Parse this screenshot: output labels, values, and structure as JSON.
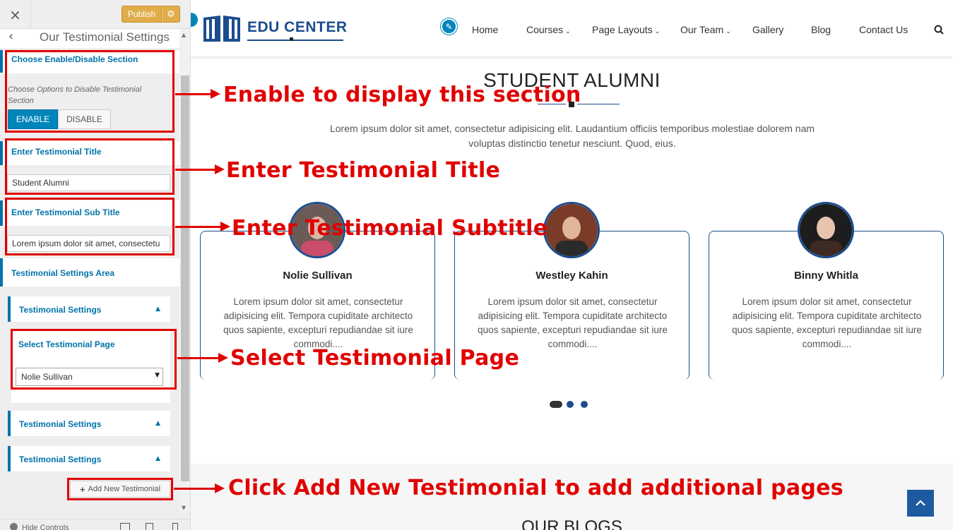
{
  "customizer": {
    "close_symbol": "×",
    "publish_label": "Publish",
    "gear_symbol": "⚙",
    "back_symbol": "‹",
    "section_title": "Our Testimonial Settings",
    "enable_section": {
      "title": "Choose Enable/Disable Section",
      "description": "Choose Options to Disable Testimonial Section",
      "enable_label": "ENABLE",
      "disable_label": "DISABLE",
      "selected": "ENABLE"
    },
    "title_field": {
      "label": "Enter Testimonial Title",
      "value": "Student Alumni"
    },
    "subtitle_field": {
      "label": "Enter Testimonial Sub Title",
      "value": "Lorem ipsum dolor sit amet, consectetu"
    },
    "settings_area_label": "Testimonial Settings Area",
    "accordions": [
      {
        "label": "Testimonial Settings",
        "caret": "▲"
      },
      {
        "label": "Testimonial Settings",
        "caret": "▲"
      },
      {
        "label": "Testimonial Settings",
        "caret": "▲"
      }
    ],
    "page_select": {
      "label": "Select Testimonial Page",
      "value": "Nolie Sullivan",
      "caret": "▼"
    },
    "add_button": {
      "plus": "+",
      "label": "Add New Testimonial"
    },
    "footer": {
      "hide_controls": "Hide Controls"
    }
  },
  "site": {
    "logo_text": "EDU CENTER",
    "edit_symbol": "✎",
    "nav": [
      {
        "label": "Home",
        "has_caret": false
      },
      {
        "label": "Courses",
        "has_caret": true
      },
      {
        "label": "Page Layouts",
        "has_caret": true
      },
      {
        "label": "Our Team",
        "has_caret": true
      },
      {
        "label": "Gallery",
        "has_caret": false
      },
      {
        "label": "Blog",
        "has_caret": false
      },
      {
        "label": "Contact Us",
        "has_caret": false
      }
    ],
    "nav_caret": "⌄",
    "alumni": {
      "title": "STUDENT ALUMNI",
      "subtitle": "Lorem ipsum dolor sit amet, consectetur adipisicing elit. Laudantium officiis temporibus molestiae dolorem nam voluptas distinctio tenetur nesciunt. Quod, eius."
    },
    "testimonials": [
      {
        "name": "Nolie Sullivan",
        "text": "Lorem ipsum dolor sit amet, consectetur adipisicing elit. Tempora cupiditate architecto quos sapiente, excepturi repudiandae sit iure commodi....",
        "avatar": "woman-beanie-photo"
      },
      {
        "name": "Westley Kahin",
        "text": "Lorem ipsum dolor sit amet, consectetur adipisicing elit. Tempora cupiditate architecto quos sapiente, excepturi repudiandae sit iure commodi....",
        "avatar": "man-leather-jacket-photo"
      },
      {
        "name": "Binny Whitla",
        "text": "Lorem ipsum dolor sit amet, consectetur adipisicing elit. Tempora cupiditate architecto quos sapiente, excepturi repudiandae sit iure commodi....",
        "avatar": "woman-dark-background-photo"
      }
    ],
    "carousel": {
      "active_index": 0,
      "count": 3
    },
    "blogs_title": "OUR BLOGS",
    "scroll_top_symbol": "︿"
  },
  "annotations": [
    "Enable to display this section",
    "Enter Testimonial Title",
    "Enter Testimonial Subtitle",
    "Select Testimonial Page",
    "Click Add New Testimonial to add additional pages"
  ],
  "colors": {
    "accent_blue": "#0073aa",
    "publish_orange": "#e0ad4a",
    "brand_navy": "#1b4d8e",
    "annotation_red": "#e00000"
  }
}
